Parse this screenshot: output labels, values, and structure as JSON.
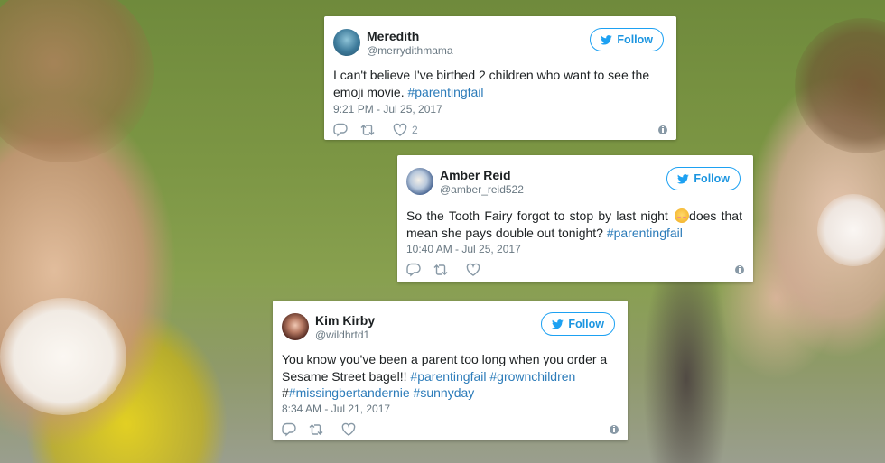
{
  "brand_color": "#1da1f2",
  "tweets": [
    {
      "name": "Meredith",
      "handle": "@merrydithmama",
      "follow_label": "Follow",
      "text_plain": "I can't believe I've birthed 2 children who want to see the emoji movie.",
      "hashtags": [
        "#parentingfail"
      ],
      "time": "9:21 PM - Jul 25, 2017",
      "like_count": "2",
      "icons": [
        "reply-icon",
        "retweet-icon",
        "heart-icon",
        "info-icon",
        "twitter-bird-icon"
      ]
    },
    {
      "name": "Amber Reid",
      "handle": "@amber_reid522",
      "follow_label": "Follow",
      "text_before_emoji": "So the Tooth Fairy forgot to stop by last night",
      "text_after_emoji": "does that mean she pays double out tonight?",
      "hashtags": [
        "#parentingfail"
      ],
      "emoji": "flushed-face-emoji",
      "time": "10:40 AM - Jul 25, 2017",
      "like_count": "",
      "icons": [
        "reply-icon",
        "retweet-icon",
        "heart-icon",
        "info-icon",
        "twitter-bird-icon"
      ]
    },
    {
      "name": "Kim Kirby",
      "handle": "@wildhrtd1",
      "follow_label": "Follow",
      "text_plain": "You know you've been a parent too long when you order a Sesame Street bagel!!",
      "hashtags": [
        "#parentingfail",
        "#grownchildren",
        "#missingbertandernie",
        "#sunnyday"
      ],
      "hash_prefix": "#",
      "time": "8:34 AM - Jul 21, 2017",
      "like_count": "",
      "icons": [
        "reply-icon",
        "retweet-icon",
        "heart-icon",
        "info-icon",
        "twitter-bird-icon"
      ]
    }
  ]
}
